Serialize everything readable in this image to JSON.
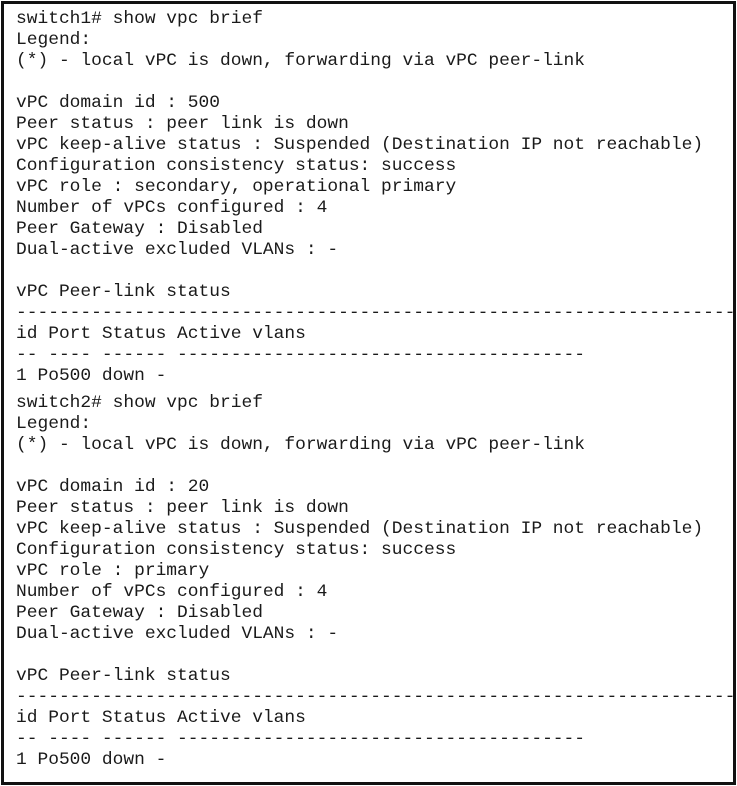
{
  "switch1": {
    "prompt": "switch1# show vpc brief",
    "legend_label": "Legend:",
    "legend_text": "(*) - local vPC is down, forwarding via vPC peer-link",
    "blank": "",
    "domain_id": "vPC domain id : 500",
    "peer_status": "Peer status : peer link is down",
    "keepalive_status": "vPC keep-alive status : Suspended (Destination IP not reachable)",
    "consistency_status": "Configuration consistency status: success",
    "role": "vPC role : secondary, operational primary",
    "num_vpcs": "Number of vPCs configured : 4",
    "peer_gateway": "Peer Gateway : Disabled",
    "dual_active_vlans": "Dual-active excluded VLANs : -",
    "peer_link_heading": "vPC Peer-link status",
    "separator_full": "---------------------------------------------------------------------",
    "table_header": "id Port Status Active vlans",
    "table_underline": "-- ---- ------ --------------------------------------",
    "table_rows": [
      {
        "text": "1 Po500 down -",
        "id": "1",
        "port": "Po500",
        "status": "down",
        "active_vlans": "-"
      }
    ]
  },
  "switch2": {
    "prompt": "switch2# show vpc brief",
    "legend_label": "Legend:",
    "legend_text": "(*) - local vPC is down, forwarding via vPC peer-link",
    "blank": "",
    "domain_id": "vPC domain id : 20",
    "peer_status": "Peer status : peer link is down",
    "keepalive_status": "vPC keep-alive status : Suspended (Destination IP not reachable)",
    "consistency_status": "Configuration consistency status: success",
    "role": "vPC role : primary",
    "num_vpcs": "Number of vPCs configured : 4",
    "peer_gateway": "Peer Gateway : Disabled",
    "dual_active_vlans": "Dual-active excluded VLANs : -",
    "peer_link_heading": "vPC Peer-link status",
    "separator_full": "---------------------------------------------------------------------",
    "table_header": "id Port Status Active vlans",
    "table_underline": "-- ---- ------ --------------------------------------",
    "table_rows": [
      {
        "text": "1 Po500 down -",
        "id": "1",
        "port": "Po500",
        "status": "down",
        "active_vlans": "-"
      }
    ]
  }
}
